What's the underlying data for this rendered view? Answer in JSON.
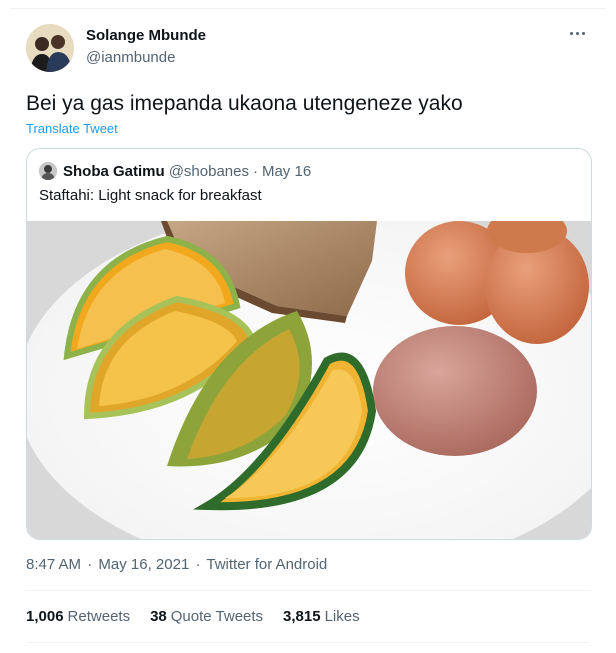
{
  "author": {
    "display_name": "Solange Mbunde",
    "handle": "@ianmbunde"
  },
  "tweet": {
    "text": "Bei ya gas imepanda ukaona utengeneze yako",
    "translate_label": "Translate Tweet"
  },
  "quoted_tweet": {
    "display_name": "Shoba Gatimu",
    "handle": "@shobanes",
    "separator": "·",
    "date": "May 16",
    "text": "Staftahi: Light snack for breakfast"
  },
  "meta": {
    "time": "8:47 AM",
    "separator": "·",
    "date": "May 16, 2021",
    "source": "Twitter for Android"
  },
  "stats": {
    "retweets_count": "1,006",
    "retweets_label": "Retweets",
    "quotes_count": "38",
    "quotes_label": "Quote Tweets",
    "likes_count": "3,815",
    "likes_label": "Likes"
  },
  "icons": {
    "more": "more-options-icon"
  },
  "colors": {
    "accent": "#1d9bf0",
    "text_primary": "#0f1419",
    "text_secondary": "#536471",
    "border": "#cfd9de"
  }
}
